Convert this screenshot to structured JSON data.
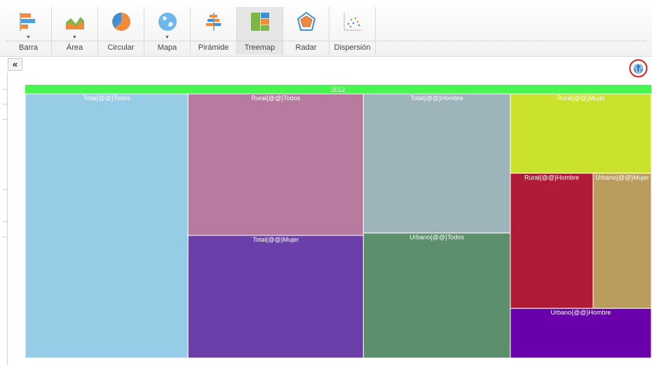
{
  "toolbar": {
    "tools": [
      {
        "label": "Barra",
        "icon": "bar-chart-icon",
        "has_dropdown": true
      },
      {
        "label": "Área",
        "icon": "area-chart-icon",
        "has_dropdown": true
      },
      {
        "label": "Circular",
        "icon": "pie-chart-icon",
        "has_dropdown": false
      },
      {
        "label": "Mapa",
        "icon": "globe-icon",
        "has_dropdown": true
      },
      {
        "label": "Pirámide",
        "icon": "pyramid-chart-icon",
        "has_dropdown": false
      },
      {
        "label": "Treemap",
        "icon": "treemap-icon",
        "has_dropdown": false,
        "active": true
      },
      {
        "label": "Radar",
        "icon": "radar-chart-icon",
        "has_dropdown": false
      },
      {
        "label": "Dispersión",
        "icon": "scatter-chart-icon",
        "has_dropdown": false
      }
    ],
    "collapse_label": "«"
  },
  "chart_data": {
    "type": "treemap",
    "root": {
      "label": "2012",
      "color": "#49f550"
    },
    "label_color": "#ffffff",
    "nodes": [
      {
        "label": "Total{@@}Todos",
        "value": 24.6,
        "color": "#96cce6"
      },
      {
        "label": "Rural{@@}Todos",
        "value": 14.2,
        "color": "#b67b9f"
      },
      {
        "label": "Total{@@}Mujer",
        "value": 12.3,
        "color": "#6a3faa"
      },
      {
        "label": "Total{@@}Hombre",
        "value": 11.7,
        "color": "#9db5ba"
      },
      {
        "label": "Urbano{@@}Todos",
        "value": 10.5,
        "color": "#5c8f6b"
      },
      {
        "label": "Rural{@@}Mujer",
        "value": 6.4,
        "color": "#cbe22c"
      },
      {
        "label": "Rural{@@}Hombre",
        "value": 6.4,
        "color": "#b01c37"
      },
      {
        "label": "Urbano{@@}Mujer",
        "value": 4.5,
        "color": "#b99c5e"
      },
      {
        "label": "Urbano{@@}Hombre",
        "value": 4.0,
        "color": "#6a00ab"
      }
    ]
  },
  "controls": {
    "up_icon": "up-arrow-icon",
    "up_color": "#e01b1b"
  }
}
